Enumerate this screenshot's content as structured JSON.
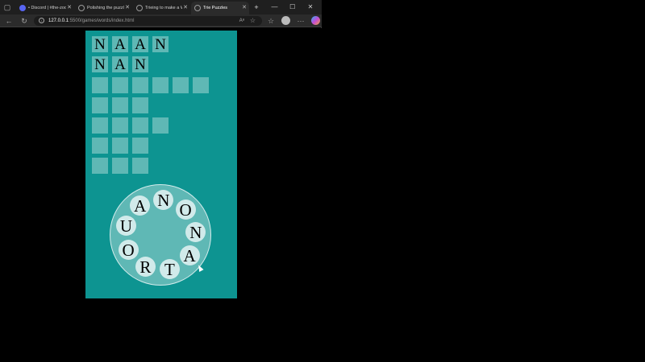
{
  "browser": {
    "tabs": [
      {
        "label": "• Discord | #the-zoo",
        "icon": "discord-icon",
        "active": false
      },
      {
        "label": "Polishing the puzzle",
        "icon": "globe-icon",
        "active": false
      },
      {
        "label": "Trieing to make a W",
        "icon": "globe-icon",
        "active": false
      },
      {
        "label": "Trie Puzzles",
        "icon": "globe-icon",
        "active": true
      }
    ],
    "new_tab": "+",
    "url_host": "127.0.0.1",
    "url_path": ":5500/games/words/index.html",
    "window_controls": {
      "minimize": "—",
      "maximize": "☐",
      "close": "✕"
    }
  },
  "game": {
    "grid_rows": [
      [
        "N",
        "A",
        "A",
        "N"
      ],
      [
        "N",
        "A",
        "N"
      ],
      [
        "",
        "",
        "",
        "",
        "",
        ""
      ],
      [
        "",
        "",
        ""
      ],
      [
        "",
        "",
        "",
        ""
      ],
      [
        "",
        "",
        ""
      ],
      [
        "",
        "",
        ""
      ]
    ],
    "wheel_letters": [
      "N",
      "O",
      "N",
      "A",
      "T",
      "R",
      "O",
      "U",
      "A"
    ],
    "colors": {
      "board": "#0d9491",
      "cell": "#5fb8b5",
      "wheel": "#5fb8b5",
      "wheel_letter_bg": "#d1eaea"
    }
  }
}
